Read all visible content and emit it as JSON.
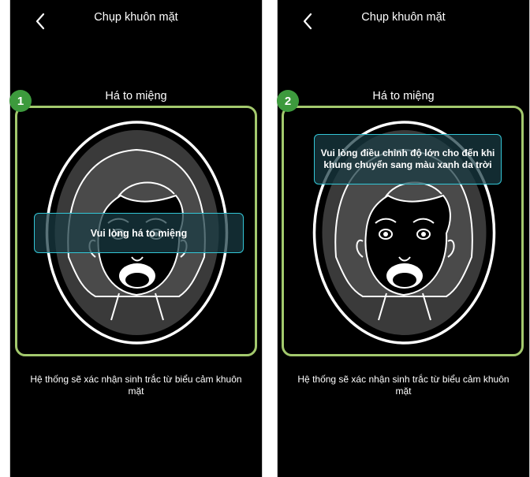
{
  "steps": [
    {
      "number": "1",
      "title": "Chụp khuôn mặt",
      "prompt": "Há to miệng",
      "overlay_message": "Vui lòng há to miệng",
      "footer": "Hệ thống sẽ xác nhận sinh trắc từ biểu cảm khuôn mặt"
    },
    {
      "number": "2",
      "title": "Chụp khuôn mặt",
      "prompt": "Há to miệng",
      "overlay_message": "Vui lòng điều chỉnh độ lớn cho đến khi khung chuyển sang màu xanh da trời",
      "footer": "Hệ thống sẽ xác nhận sinh trắc từ biểu cảm khuôn mặt"
    }
  ],
  "icons": {
    "back": "chevron-left-icon",
    "face": "face-mouth-open-icon"
  },
  "colors": {
    "screen_bg": "#000000",
    "frame_border": "#a3c96d",
    "overlay_border": "#33c6d6",
    "badge_bg": "#3d9a3d"
  }
}
